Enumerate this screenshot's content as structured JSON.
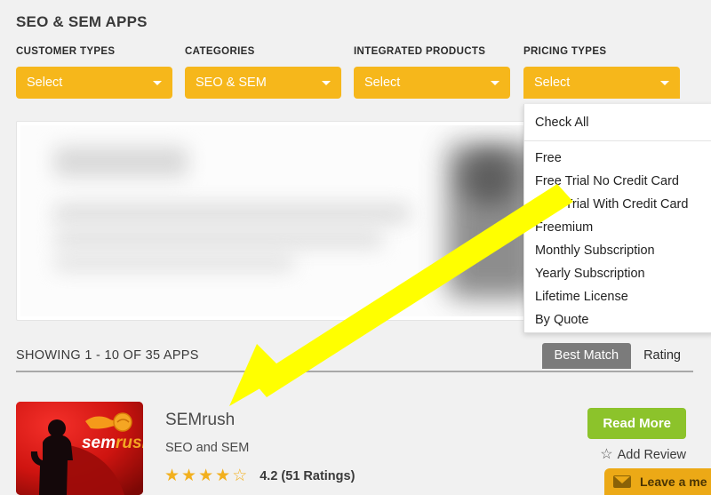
{
  "page": {
    "title": "SEO & SEM APPS",
    "background_color": "#f1f1f1"
  },
  "filters": [
    {
      "label": "CUSTOMER TYPES",
      "value": "Select",
      "open": false
    },
    {
      "label": "CATEGORIES",
      "value": "SEO & SEM",
      "open": false
    },
    {
      "label": "INTEGRATED PRODUCTS",
      "value": "Select",
      "open": false
    },
    {
      "label": "PRICING TYPES",
      "value": "Select",
      "open": true
    }
  ],
  "pricing_dropdown": {
    "check_all_label": "Check All",
    "options": [
      "Free",
      "Free Trial No Credit Card",
      "Free Trial With Credit Card",
      "Freemium",
      "Monthly Subscription",
      "Yearly Subscription",
      "Lifetime License",
      "By Quote"
    ]
  },
  "results": {
    "showing_text": "SHOWING 1 - 10 OF 35 APPS",
    "sort_tabs": [
      {
        "label": "Best Match",
        "active": true
      },
      {
        "label": "Rating",
        "active": false
      }
    ]
  },
  "listing": {
    "name": "SEMrush",
    "category": "SEO and SEM",
    "logo_wordmark": "semrush",
    "stars_filled": 4,
    "stars_total": 5,
    "rating_text": "4.2 (51 Ratings)",
    "read_more_label": "Read More",
    "add_review_label": "Add Review"
  },
  "chat_widget": {
    "label": "Leave a me"
  },
  "colors": {
    "accent_amber": "#f6b71b",
    "button_green": "#8cc32b",
    "star_gold": "#f2b01e",
    "annotation_yellow": "#ffff00",
    "tab_active_gray": "#7b7b7b"
  }
}
